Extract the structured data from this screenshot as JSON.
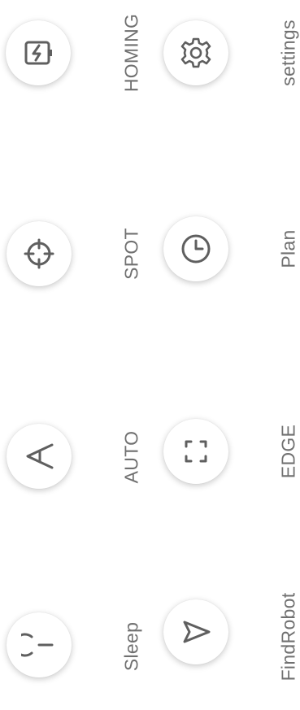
{
  "buttons": [
    {
      "id": "homing",
      "label": "HOMING",
      "icon": "battery-charging-icon"
    },
    {
      "id": "settings",
      "label": "settings",
      "icon": "gear-icon"
    },
    {
      "id": "spot",
      "label": "SPOT",
      "icon": "crosshair-icon"
    },
    {
      "id": "plan",
      "label": "Plan",
      "icon": "clock-icon"
    },
    {
      "id": "auto",
      "label": "AUTO",
      "icon": "letter-a-icon"
    },
    {
      "id": "edge",
      "label": "EDGE",
      "icon": "frame-corners-icon"
    },
    {
      "id": "sleep",
      "label": "Sleep",
      "icon": "power-icon"
    },
    {
      "id": "findrobot",
      "label": "FindRobot",
      "icon": "navigation-arrow-icon"
    }
  ],
  "colors": {
    "icon": "#5f5f5f",
    "label": "#707070",
    "background": "#ffffff"
  }
}
